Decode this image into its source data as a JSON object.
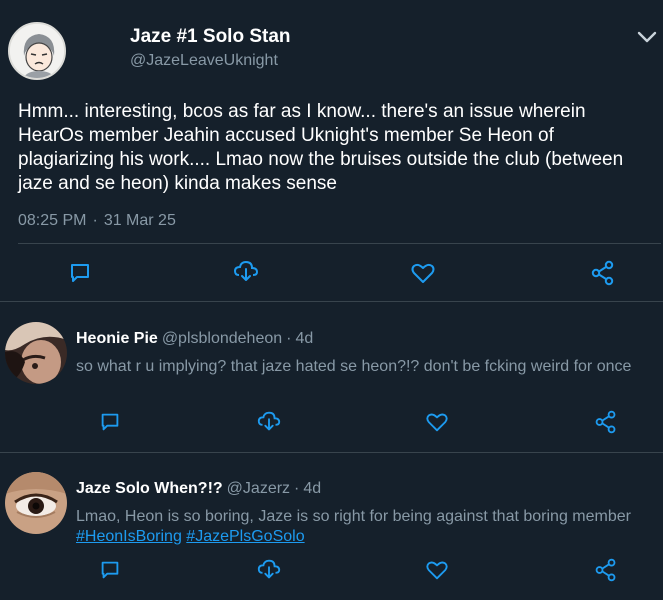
{
  "main_tweet": {
    "display_name": "Jaze #1 Solo Stan",
    "handle": "@JazeLeaveUknight",
    "text": "Hmm... interesting, bcos as far as I know... there's an issue wherein HearOs member Jeahin accused Uknight's member Se Heon of plagiarizing his work.... Lmao now the bruises outside the club (between jaze and se heon) kinda makes sense",
    "time": "08:25 PM",
    "separator": "·",
    "date": "31 Mar 25",
    "icons": [
      "chevron-down-icon",
      "reply-icon",
      "retweet-icon",
      "like-icon",
      "share-icon"
    ]
  },
  "replies": [
    {
      "display_name": "Heonie Pie",
      "handle": "@plsblondeheon",
      "separator": "·",
      "time": "4d",
      "text": "so what r u implying? that jaze hated se heon?!? don't be fcking weird for once",
      "hashtags": []
    },
    {
      "display_name": "Jaze Solo When?!?",
      "handle": "@Jazerz",
      "separator": "·",
      "time": "4d",
      "text": "Lmao, Heon is so boring, Jaze is so right for being against that boring member",
      "hashtags": [
        "#HeonIsBoring",
        "#JazePlsGoSolo"
      ]
    }
  ],
  "colors": {
    "background": "#15202b",
    "secondary_text": "#8899a6",
    "divider": "#38444d",
    "accent": "#1d9bf0"
  }
}
